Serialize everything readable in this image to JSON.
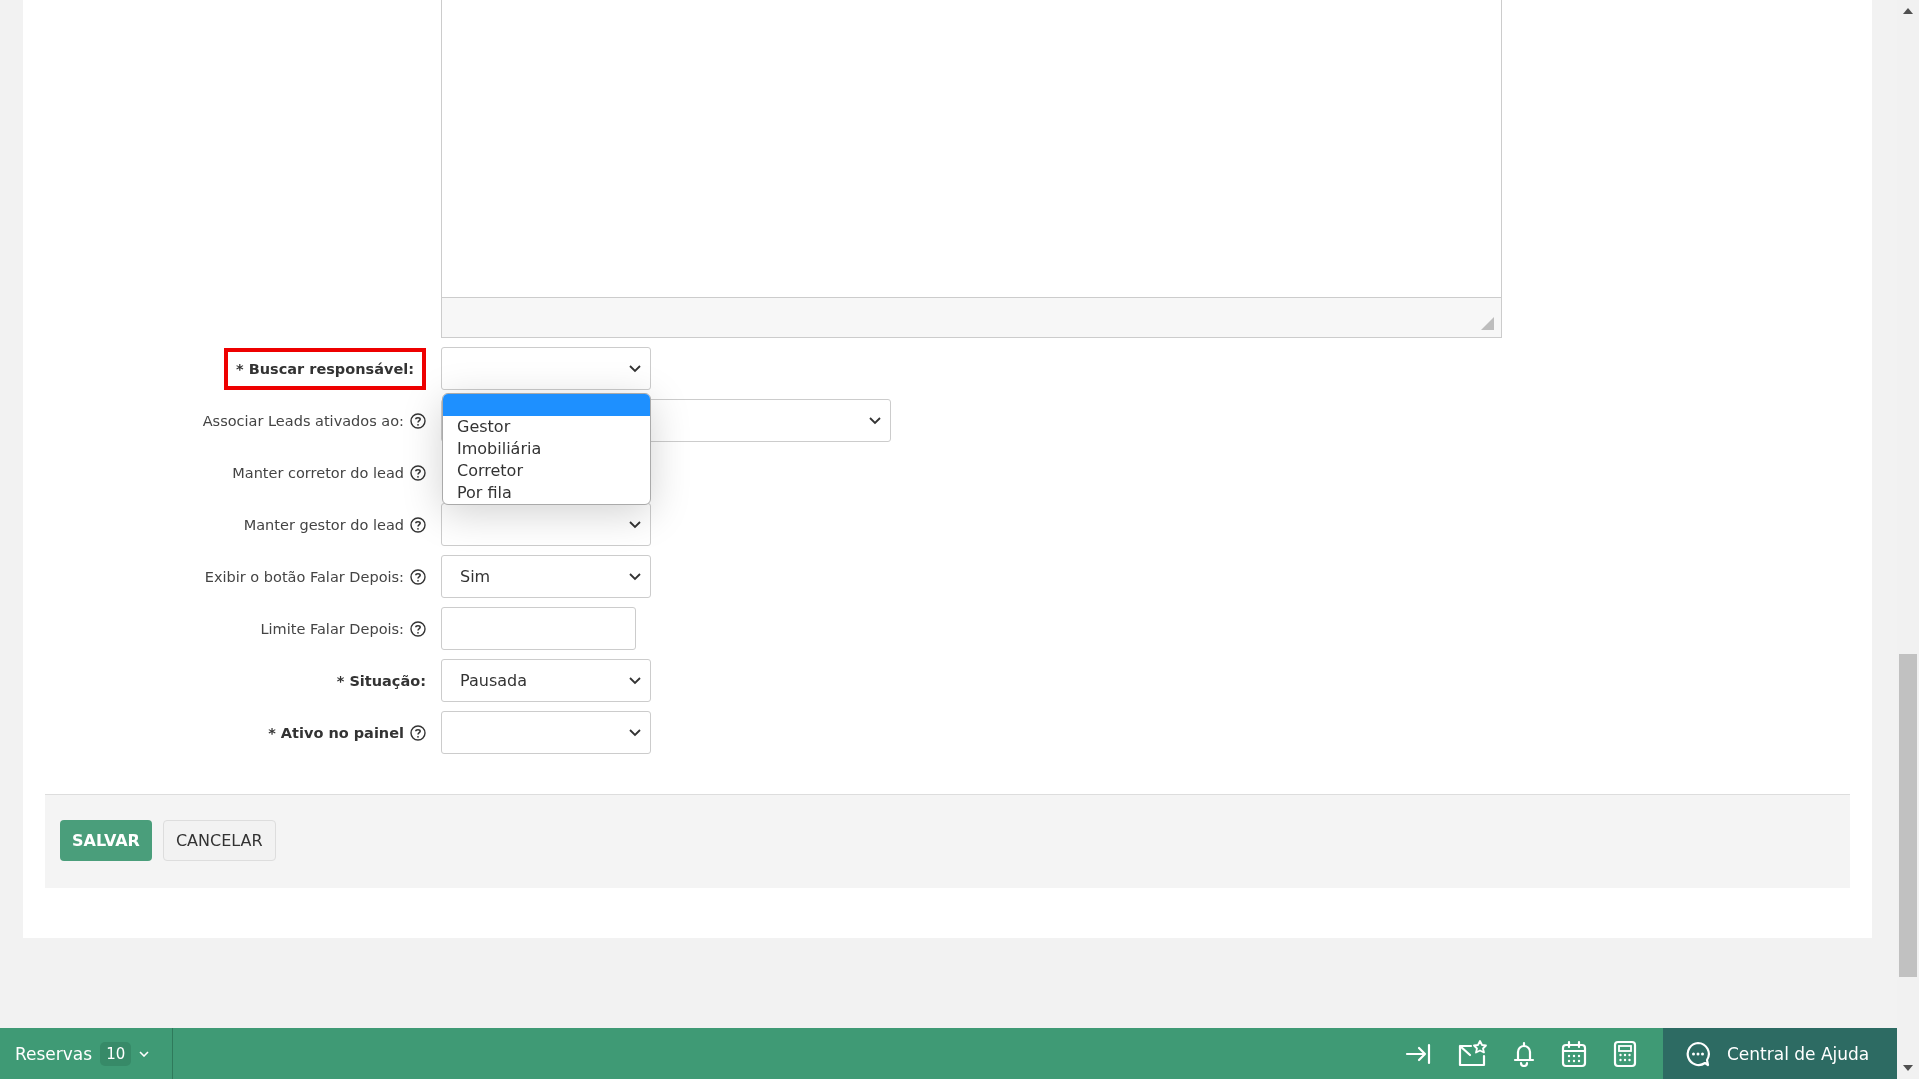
{
  "form": {
    "fields": [
      {
        "label": "* Buscar responsável:",
        "required": true,
        "help": false,
        "highlighted": true,
        "kind": "select"
      },
      {
        "label": "Associar Leads ativados ao:",
        "required": false,
        "help": true,
        "highlighted": false,
        "kind": "wide"
      },
      {
        "label": "Manter corretor do lead",
        "required": false,
        "help": true,
        "highlighted": false,
        "kind": "hidden"
      },
      {
        "label": "Manter gestor do lead",
        "required": false,
        "help": true,
        "highlighted": false,
        "kind": "select"
      },
      {
        "label": "Exibir o botão Falar Depois:",
        "required": false,
        "help": true,
        "highlighted": false,
        "kind": "select",
        "value": "Sim"
      },
      {
        "label": "Limite Falar Depois:",
        "required": false,
        "help": true,
        "highlighted": false,
        "kind": "input"
      },
      {
        "label": "* Situação:",
        "required": true,
        "help": false,
        "highlighted": false,
        "kind": "select",
        "value": "Pausada"
      },
      {
        "label": "* Ativo no painel",
        "required": true,
        "help": true,
        "highlighted": false,
        "kind": "select"
      }
    ]
  },
  "dropdown": {
    "blank_selected": true,
    "options": [
      {
        "label": "Gestor",
        "selected": false
      },
      {
        "label": "Imobiliária",
        "selected": false
      },
      {
        "label": "Corretor",
        "selected": false
      },
      {
        "label": "Por fila",
        "selected": false
      }
    ]
  },
  "buttons": [
    {
      "label": "SALVAR",
      "kind": "primary"
    },
    {
      "label": "CANCELAR",
      "kind": "secondary"
    }
  ],
  "bottom_bar": {
    "reservas": {
      "label": "Reservas",
      "count": "10"
    },
    "help_center": "Central de Ajuda"
  }
}
